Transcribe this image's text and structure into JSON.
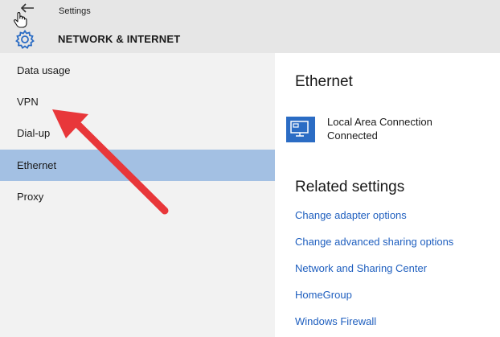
{
  "header": {
    "breadcrumb": "Settings",
    "section_title": "NETWORK & INTERNET",
    "back_icon": "back-arrow-icon",
    "settings_icon": "gear-icon",
    "colors": {
      "header_bg": "#e6e6e6"
    }
  },
  "sidebar": {
    "items": [
      {
        "label": "Data usage",
        "selected": false
      },
      {
        "label": "VPN",
        "selected": false
      },
      {
        "label": "Dial-up",
        "selected": false
      },
      {
        "label": "Ethernet",
        "selected": true
      },
      {
        "label": "Proxy",
        "selected": false
      }
    ],
    "colors": {
      "bg": "#f2f2f2",
      "selected_bg": "#a3c0e3"
    }
  },
  "main": {
    "title": "Ethernet",
    "connection": {
      "name": "Local Area Connection",
      "status": "Connected",
      "icon": "ethernet-monitor-icon"
    },
    "related_title": "Related settings",
    "links": [
      "Change adapter options",
      "Change advanced sharing options",
      "Network and Sharing Center",
      "HomeGroup",
      "Windows Firewall"
    ],
    "colors": {
      "link": "#1f5fbf",
      "icon_blue": "#2b6cc4"
    }
  },
  "annotation": {
    "type": "red-arrow",
    "color": "#e8373a",
    "points_to": "VPN"
  }
}
